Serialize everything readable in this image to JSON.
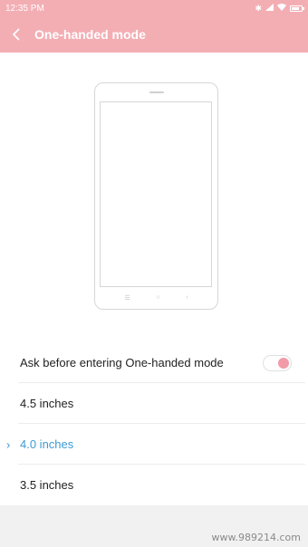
{
  "status_bar": {
    "time": "12:35 PM",
    "bluetooth_icon": "bluetooth-icon",
    "signal_icon": "signal-icon",
    "wifi_icon": "wifi-icon",
    "battery_icon": "battery-icon",
    "battery_level": 0.8
  },
  "header": {
    "title": "One-handed mode",
    "back_icon": "chevron-left-icon",
    "background_color": "#f3aeb4"
  },
  "settings": {
    "ask_toggle": {
      "label": "Ask before entering One-handed mode",
      "enabled": true,
      "accent_color": "#f29aa8"
    },
    "sizes": [
      {
        "label": "4.5 inches",
        "selected": false
      },
      {
        "label": "4.0 inches",
        "selected": true
      },
      {
        "label": "3.5 inches",
        "selected": false
      }
    ],
    "selected_color": "#3c9ad6"
  },
  "watermark": "www.989214.com"
}
